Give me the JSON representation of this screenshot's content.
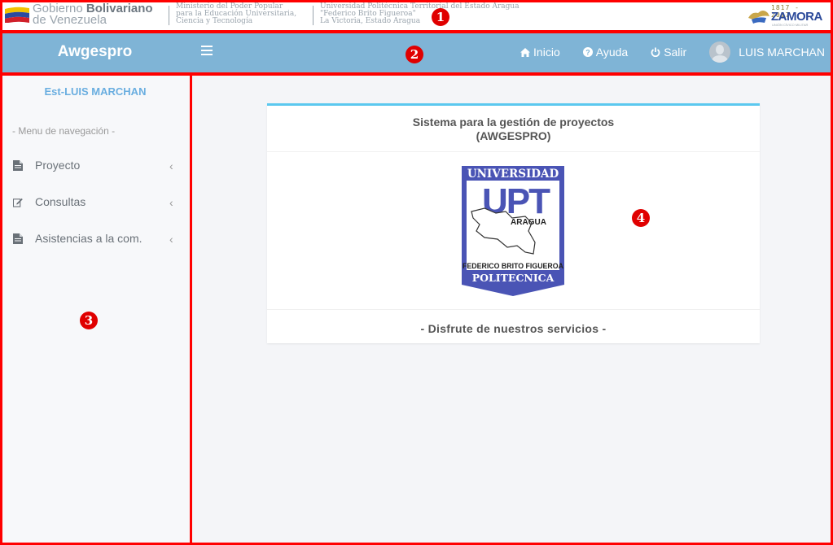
{
  "gov_banner": {
    "gov_name_light": "Gobierno",
    "gov_name_bold": "Bolivariano",
    "gov_name_line2": "de Venezuela",
    "ministry_lines": [
      "Ministerio del Poder Popular",
      "para la Educación Universitaria,",
      "Ciencia y Tecnología"
    ],
    "university_lines": [
      "Universidad Politécnica Territorial del Estado Aragua",
      "\"Federico Brito Figueroa\"",
      "La Victoria, Estado Aragua"
    ],
    "zamora_years": "1817 - 2017",
    "zamora_word": "ZAMORA",
    "zamora_sub": "UNIÓN CÍVICO MILITAR"
  },
  "topbar": {
    "brand": "Awgespro",
    "nav": {
      "inicio": "Inicio",
      "ayuda": "Ayuda",
      "salir": "Salir",
      "user": "LUIS MARCHAN"
    }
  },
  "sidebar": {
    "user": "Est-LUIS MARCHAN",
    "header": "- Menu de navegación -",
    "items": [
      {
        "label": "Proyecto",
        "icon": "file-icon"
      },
      {
        "label": "Consultas",
        "icon": "edit-icon"
      },
      {
        "label": "Asistencias a la com.",
        "icon": "file-icon"
      }
    ]
  },
  "main": {
    "card_title_line1": "Sistema para la gestión de proyectos",
    "card_title_line2": "(AWGESPRO)",
    "logo": {
      "top": "UNIVERSIDAD",
      "mid": "UPT",
      "state": "ARAGUA",
      "name": "FEDERICO BRITO FIGUEROA",
      "bottom": "POLITECNICA"
    },
    "footer": "- Disfrute de nuestros servicios -"
  },
  "annotations": [
    "1",
    "2",
    "3",
    "4"
  ],
  "colors": {
    "topbar": "#7fb4d6",
    "accent": "#5bc8ef",
    "annotation": "#ff0000",
    "logo_blue": "#4a54b5"
  }
}
